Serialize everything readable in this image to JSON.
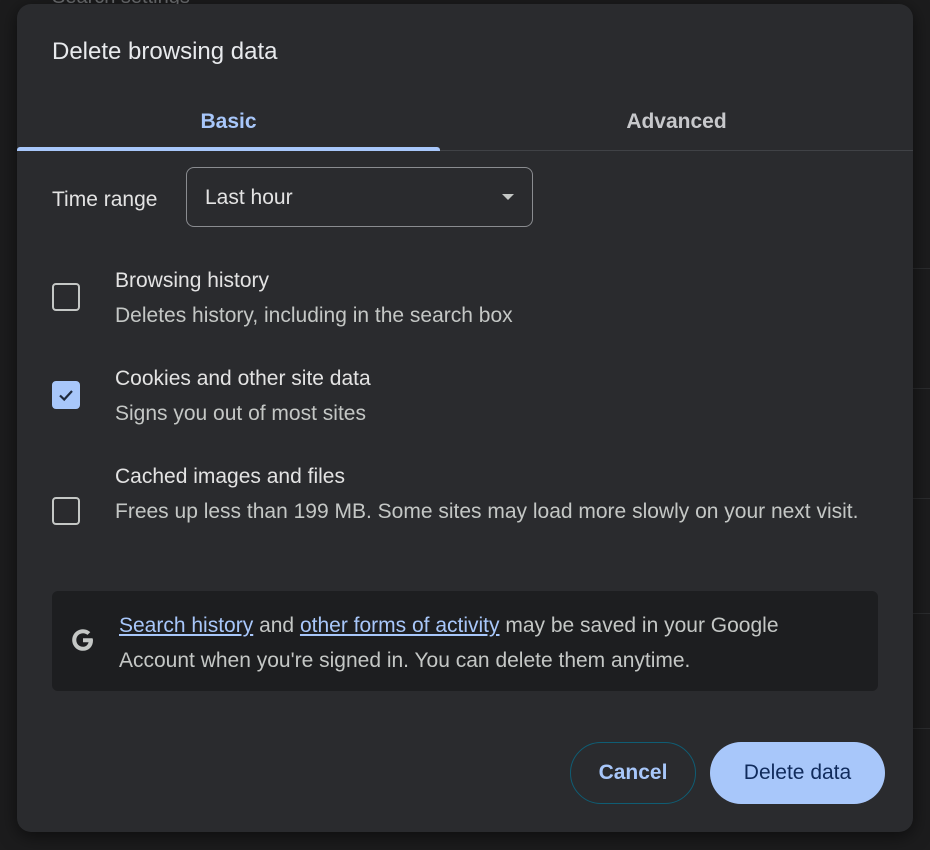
{
  "background": {
    "peek_text": "Search settings"
  },
  "dialog": {
    "title": "Delete browsing data",
    "tabs": [
      {
        "label": "Basic",
        "selected": true
      },
      {
        "label": "Advanced",
        "selected": false
      }
    ],
    "time_range": {
      "label": "Time range",
      "value": "Last hour"
    },
    "options": [
      {
        "title": "Browsing history",
        "description": "Deletes history, including in the search box",
        "checked": false
      },
      {
        "title": "Cookies and other site data",
        "description": "Signs you out of most sites",
        "checked": true
      },
      {
        "title": "Cached images and files",
        "description": "Frees up less than 199 MB. Some sites may load more slowly on your next visit.",
        "checked": false
      }
    ],
    "info": {
      "icon": "google-g-icon",
      "link1": "Search history",
      "text1": " and ",
      "link2": "other forms of activity",
      "text2": " may be saved in your Google Account when you're signed in. You can delete them anytime."
    },
    "buttons": {
      "cancel": "Cancel",
      "delete": "Delete data"
    }
  },
  "colors": {
    "accent": "#a8c7fa",
    "dialog_bg": "#2a2b2e",
    "info_bg": "#1d1e20"
  }
}
